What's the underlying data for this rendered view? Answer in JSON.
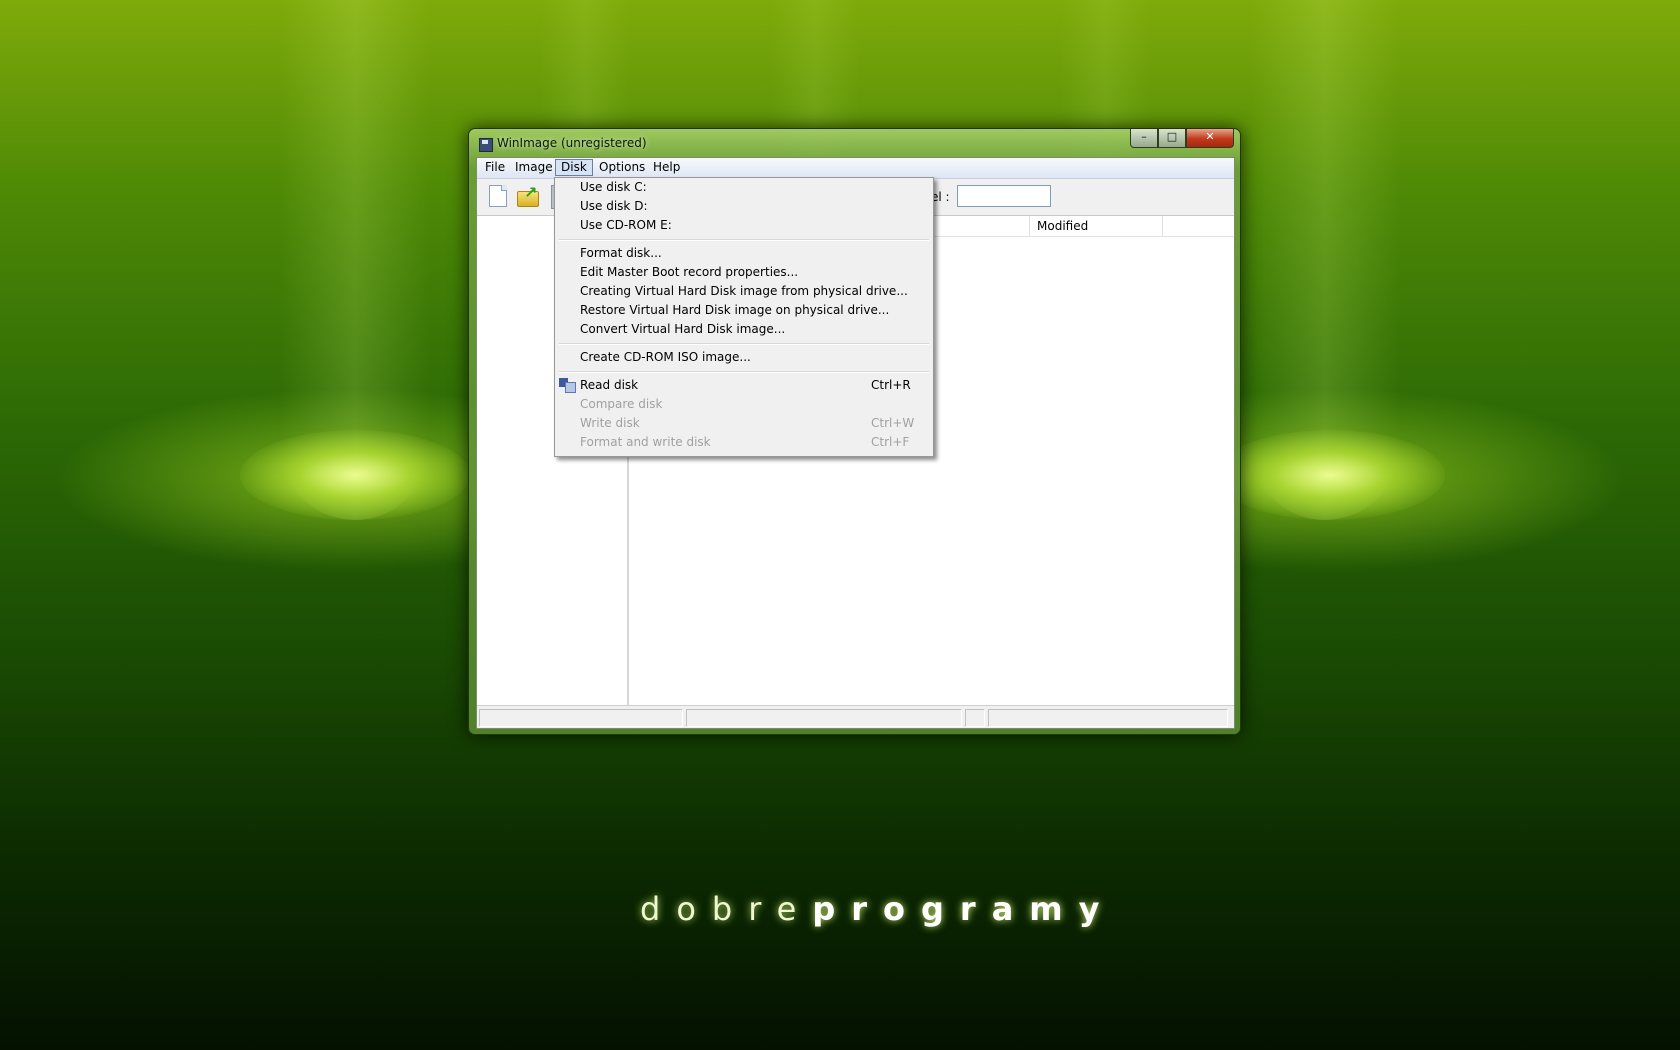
{
  "brand": {
    "light": "dobre",
    "bold": "programy"
  },
  "window": {
    "title": "WinImage (unregistered)",
    "controls": {
      "minimize": "–",
      "maximize": "□",
      "close": "✕"
    }
  },
  "menubar": [
    "File",
    "Image",
    "Disk",
    "Options",
    "Help"
  ],
  "toolbar": {
    "label_text": "el :",
    "label_value": ""
  },
  "list": {
    "columns": [
      "Modified"
    ]
  },
  "disk_menu": {
    "group1": [
      "Use disk C:",
      "Use disk D:",
      "Use CD-ROM E:"
    ],
    "group2": [
      "Format disk...",
      "Edit Master Boot record properties...",
      "Creating Virtual Hard Disk image from physical drive...",
      "Restore Virtual Hard Disk image on physical drive...",
      "Convert Virtual Hard Disk image..."
    ],
    "group3": [
      "Create CD-ROM ISO image..."
    ],
    "group4": [
      {
        "label": "Read disk",
        "shortcut": "Ctrl+R",
        "enabled": true,
        "icon": "read-disk-icon"
      },
      {
        "label": "Compare disk",
        "shortcut": "",
        "enabled": false
      },
      {
        "label": "Write disk",
        "shortcut": "Ctrl+W",
        "enabled": false
      },
      {
        "label": "Format and write disk",
        "shortcut": "Ctrl+F",
        "enabled": false
      }
    ]
  },
  "colors": {
    "wallpaper_green": "#2d6a05",
    "menu_bg": "#f0f0f0",
    "disabled_text": "#a0a0a0"
  }
}
